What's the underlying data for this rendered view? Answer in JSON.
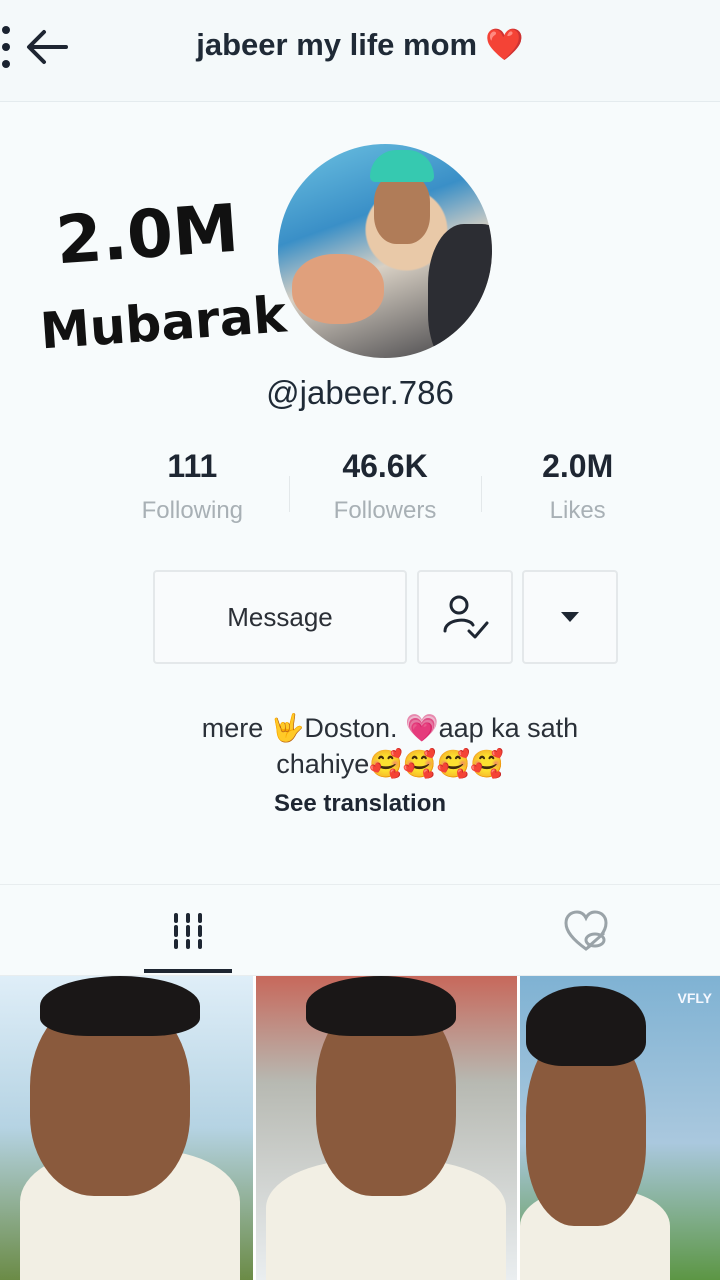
{
  "header": {
    "title": "jabeer my life mom",
    "title_emoji": "❤️",
    "back_icon": "back-arrow-icon",
    "menu_icon": "more-vertical-icon"
  },
  "overlay": {
    "line1": "2.0M",
    "line2": "Mubarak"
  },
  "profile": {
    "username": "@jabeer.786"
  },
  "stats": {
    "following": {
      "value": "111",
      "label": "Following"
    },
    "followers": {
      "value": "46.6K",
      "label": "Followers"
    },
    "likes": {
      "value": "2.0M",
      "label": "Likes"
    }
  },
  "actions": {
    "message_label": "Message",
    "follow_icon": "user-check-icon",
    "dropdown_icon": "caret-down-icon"
  },
  "bio": {
    "line1": "mere 🤟Doston. 💗aap ka sath",
    "line2": "chahiye🥰🥰🥰🥰",
    "translate_label": "See translation"
  },
  "tabs": {
    "videos_icon": "grid-icon",
    "liked_icon": "hidden-heart-icon"
  },
  "grid": {
    "watermark": "VFLY"
  },
  "colors": {
    "text": "#1e2632",
    "muted": "#a8b0b5",
    "heart": "#ef3b3b"
  }
}
